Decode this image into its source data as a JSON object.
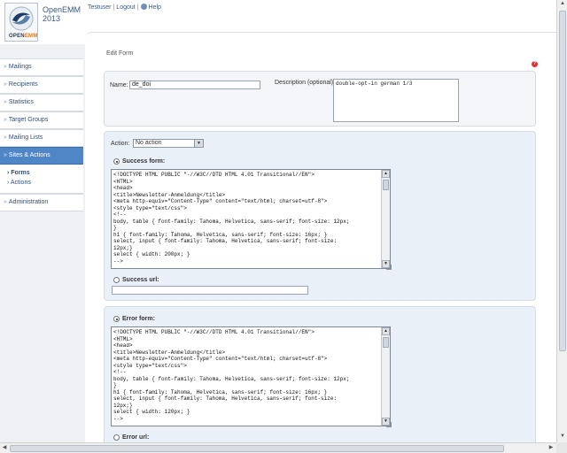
{
  "app": {
    "name_line1": "OpenEMM",
    "name_line2": "2013",
    "logo_text_a": "OPEN",
    "logo_text_b": "EMM"
  },
  "topnav": {
    "user": "Testuser",
    "logout": "Logout",
    "help": "Help"
  },
  "sidebar": {
    "items": [
      {
        "label": "Mailings"
      },
      {
        "label": "Recipients"
      },
      {
        "label": "Statistics"
      },
      {
        "label": "Target Groups"
      },
      {
        "label": "Mailing Lists"
      },
      {
        "label": "Sites & Actions"
      },
      {
        "label": "Administration"
      }
    ],
    "subitems": [
      {
        "label": "Forms"
      },
      {
        "label": "Actions"
      }
    ]
  },
  "breadcrumb": "Edit Form",
  "form": {
    "name_label": "Name:",
    "name_value": "de_doi",
    "description_label": "Description (optional):",
    "description_value": "double-opt-in german 1/3"
  },
  "action": {
    "label": "Action:",
    "selected": "No action"
  },
  "success": {
    "form_label": "Success form:",
    "code": "<!DOCTYPE HTML PUBLIC \"-//W3C//DTD HTML 4.01 Transitional//EN\">\n<HTML>\n<head>\n<title>Newsletter-Anmeldung</title>\n<meta http-equiv=\"Content-Type\" content=\"text/html; charset=utf-8\">\n<style type=\"text/css\">\n<!--\nbody, table { font-family: Tahoma, Helvetica, sans-serif; font-size: 12px;\n}\nh1 { font-family: Tahoma, Helvetica, sans-serif; font-size: 16px; }\nselect, input { font-family: Tahoma, Helvetica, sans-serif; font-size:\n12px;}\nselect { width: 200px; }\n-->",
    "url_label": "Success url:",
    "url_value": ""
  },
  "error": {
    "form_label": "Error form:",
    "code": "<!DOCTYPE HTML PUBLIC \"-//W3C//DTD HTML 4.01 Transitional//EN\">\n<HTML>\n<head>\n<title>Newsletter-Anmeldung</title>\n<meta http-equiv=\"Content-Type\" content=\"text/html; charset=utf-8\">\n<style type=\"text/css\">\n<!--\nbody, table { font-family: Tahoma, Helvetica, sans-serif; font-size: 12px;\n}\nh1 { font-family: Tahoma, Helvetica, sans-serif; font-size: 16px; }\nselect, input { font-family: Tahoma, Helvetica, sans-serif; font-size:\n12px;}\nselect { width: 120px; }\n-->",
    "url_label": "Error url:"
  }
}
